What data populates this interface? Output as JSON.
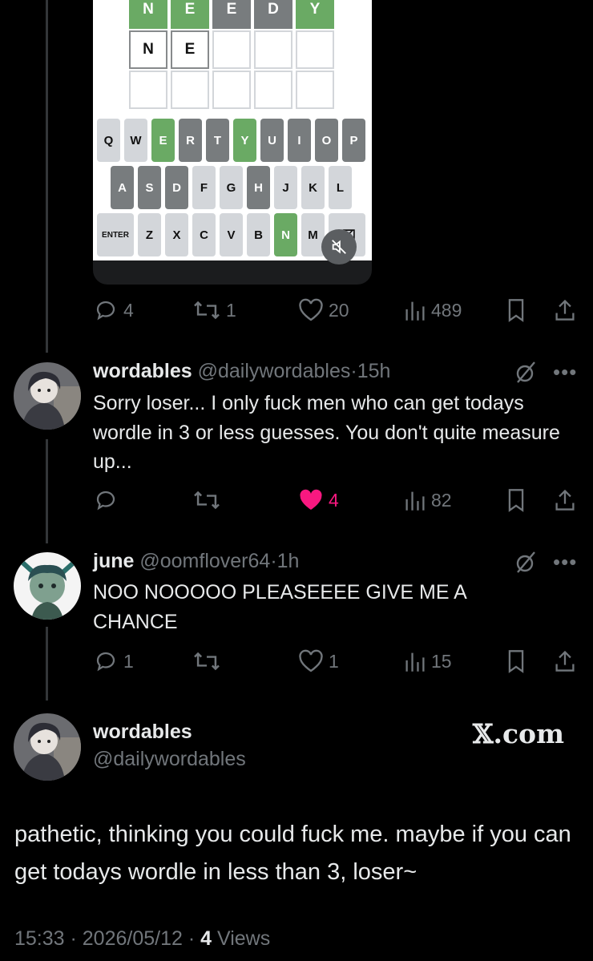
{
  "wordle": {
    "rows": [
      [
        {
          "l": "N",
          "s": "green"
        },
        {
          "l": "E",
          "s": "green"
        },
        {
          "l": "E",
          "s": "gray"
        },
        {
          "l": "D",
          "s": "gray"
        },
        {
          "l": "Y",
          "s": "green"
        }
      ],
      [
        {
          "l": "N",
          "s": "filled"
        },
        {
          "l": "E",
          "s": "filled"
        },
        {
          "l": "",
          "s": "empty"
        },
        {
          "l": "",
          "s": "empty"
        },
        {
          "l": "",
          "s": "empty"
        }
      ],
      [
        {
          "l": "",
          "s": "empty"
        },
        {
          "l": "",
          "s": "empty"
        },
        {
          "l": "",
          "s": "empty"
        },
        {
          "l": "",
          "s": "empty"
        },
        {
          "l": "",
          "s": "empty"
        }
      ]
    ],
    "keyboard": {
      "row1": [
        {
          "k": "Q"
        },
        {
          "k": "W"
        },
        {
          "k": "E",
          "s": "green"
        },
        {
          "k": "R",
          "s": "gray"
        },
        {
          "k": "T",
          "s": "gray"
        },
        {
          "k": "Y",
          "s": "green"
        },
        {
          "k": "U",
          "s": "gray"
        },
        {
          "k": "I",
          "s": "gray"
        },
        {
          "k": "O",
          "s": "gray"
        },
        {
          "k": "P",
          "s": "gray"
        }
      ],
      "row2": [
        {
          "k": "A",
          "s": "gray"
        },
        {
          "k": "S",
          "s": "gray"
        },
        {
          "k": "D",
          "s": "gray"
        },
        {
          "k": "F"
        },
        {
          "k": "G"
        },
        {
          "k": "H",
          "s": "gray"
        },
        {
          "k": "J"
        },
        {
          "k": "K"
        },
        {
          "k": "L"
        }
      ],
      "row3": [
        {
          "k": "ENTER"
        },
        {
          "k": "Z"
        },
        {
          "k": "X"
        },
        {
          "k": "C"
        },
        {
          "k": "V"
        },
        {
          "k": "B"
        },
        {
          "k": "N",
          "s": "green"
        },
        {
          "k": "M"
        },
        {
          "k": "⌫"
        }
      ]
    }
  },
  "post1": {
    "replies": "4",
    "reposts": "1",
    "likes": "20",
    "views": "489"
  },
  "post2": {
    "name": "wordables",
    "handle": "@dailywordables",
    "time": "15h",
    "text": "Sorry loser... I only fuck men who can get todays wordle in 3 or less guesses. You don't quite measure up...",
    "replies": "",
    "reposts": "",
    "likes": "4",
    "views": "82"
  },
  "post3": {
    "name": "june",
    "handle": "@oomflover64",
    "time": "1h",
    "text": "NOO NOOOOO PLEASEEEE GIVE ME A CHANCE",
    "replies": "1",
    "reposts": "",
    "likes": "1",
    "views": "15"
  },
  "post4": {
    "name": "wordables",
    "handle": "@dailywordables",
    "site": "𝕏.com",
    "text": "pathetic, thinking you could fuck me. maybe if you can get todays wordle in less than 3, loser~",
    "time": "15:33",
    "date": "2026/05/12",
    "views_count": "4",
    "views_label": "Views"
  },
  "colors": {
    "green": "#6aaa64",
    "gray": "#787c7e",
    "like": "#f91880",
    "muted": "#71767b"
  }
}
